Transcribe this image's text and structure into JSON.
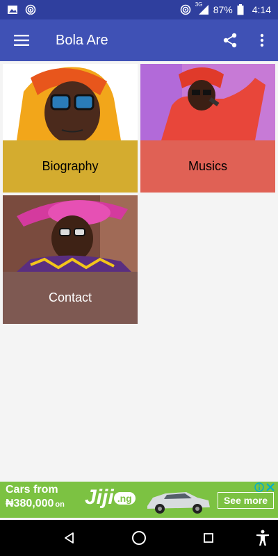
{
  "status_bar": {
    "battery": "87%",
    "time": "4:14",
    "network": "3G",
    "icons": [
      "image-icon",
      "hotspot-icon",
      "hotspot-icon",
      "signal-icon",
      "battery-icon"
    ]
  },
  "app_bar": {
    "title": "Bola Are",
    "icons": [
      "menu-icon",
      "share-icon",
      "more-vert-icon"
    ],
    "color": "#3f51b5"
  },
  "tiles": [
    {
      "label": "Biography",
      "color": "#d4ac2f",
      "text_color": "#000000"
    },
    {
      "label": "Musics",
      "color": "#e06155",
      "text_color": "#000000"
    },
    {
      "label": "Contact",
      "color": "#7e5952",
      "text_color": "#ffffff"
    }
  ],
  "ad": {
    "line1": "Cars from",
    "line2": "₦380,000",
    "on": "on",
    "logo": "Jiji",
    "logo_suffix": ".ng",
    "cta": "See more",
    "color": "#7cc242"
  },
  "nav_bar": {
    "icons": [
      "back-icon",
      "home-icon",
      "recents-icon",
      "accessibility-icon"
    ]
  }
}
